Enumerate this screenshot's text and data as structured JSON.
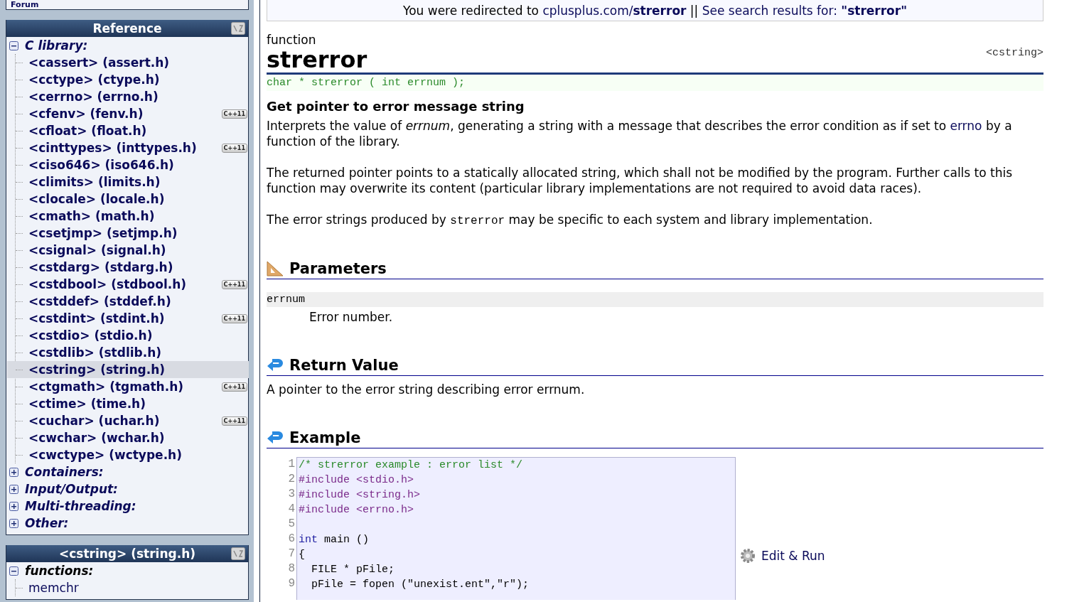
{
  "sidebar": {
    "forum_label": "Forum",
    "reference": {
      "title": "Reference",
      "groups": [
        {
          "label": "C library:",
          "expanded": true,
          "items": [
            {
              "label": "<cassert> (assert.h)",
              "selected": false
            },
            {
              "label": "<cctype> (ctype.h)",
              "selected": false
            },
            {
              "label": "<cerrno> (errno.h)",
              "selected": false
            },
            {
              "label": "<cfenv> (fenv.h)",
              "selected": false,
              "badge": "C++11"
            },
            {
              "label": "<cfloat> (float.h)",
              "selected": false
            },
            {
              "label": "<cinttypes> (inttypes.h)",
              "selected": false,
              "badge": "C++11"
            },
            {
              "label": "<ciso646> (iso646.h)",
              "selected": false
            },
            {
              "label": "<climits> (limits.h)",
              "selected": false
            },
            {
              "label": "<clocale> (locale.h)",
              "selected": false
            },
            {
              "label": "<cmath> (math.h)",
              "selected": false
            },
            {
              "label": "<csetjmp> (setjmp.h)",
              "selected": false
            },
            {
              "label": "<csignal> (signal.h)",
              "selected": false
            },
            {
              "label": "<cstdarg> (stdarg.h)",
              "selected": false
            },
            {
              "label": "<cstdbool> (stdbool.h)",
              "selected": false,
              "badge": "C++11"
            },
            {
              "label": "<cstddef> (stddef.h)",
              "selected": false
            },
            {
              "label": "<cstdint> (stdint.h)",
              "selected": false,
              "badge": "C++11"
            },
            {
              "label": "<cstdio> (stdio.h)",
              "selected": false
            },
            {
              "label": "<cstdlib> (stdlib.h)",
              "selected": false
            },
            {
              "label": "<cstring> (string.h)",
              "selected": true
            },
            {
              "label": "<ctgmath> (tgmath.h)",
              "selected": false,
              "badge": "C++11"
            },
            {
              "label": "<ctime> (time.h)",
              "selected": false
            },
            {
              "label": "<cuchar> (uchar.h)",
              "selected": false,
              "badge": "C++11"
            },
            {
              "label": "<cwchar> (wchar.h)",
              "selected": false
            },
            {
              "label": "<cwctype> (wctype.h)",
              "selected": false
            }
          ]
        },
        {
          "label": "Containers:",
          "expanded": false
        },
        {
          "label": "Input/Output:",
          "expanded": false
        },
        {
          "label": "Multi-threading:",
          "expanded": false
        },
        {
          "label": "Other:",
          "expanded": false
        }
      ]
    },
    "header_panel": {
      "title": "<cstring> (string.h)",
      "groups": [
        {
          "label": "functions:",
          "expanded": true,
          "items": [
            {
              "label": "memchr",
              "selected": false
            }
          ]
        }
      ]
    }
  },
  "redirect_bar": [
    {
      "kind": "text",
      "text": "You were redirected to "
    },
    {
      "kind": "link",
      "text": "cplusplus.com/**strerror**"
    },
    {
      "kind": "text",
      "text": " || "
    },
    {
      "kind": "link",
      "text": "See search results for: **\"strerror\"**"
    }
  ],
  "article": {
    "kind_label": "function",
    "title": "strerror",
    "header": "<cstring>",
    "signature": "char * strerror ( int errnum );",
    "summary": "Get pointer to error message string",
    "paragraphs": [
      [
        {
          "kind": "text",
          "text": "Interprets the value of *errnum*, generating a string with a message that describes the error condition as if set to "
        },
        {
          "kind": "link",
          "text": "errno"
        },
        {
          "kind": "text",
          "text": " by a function of the library."
        }
      ],
      [
        {
          "kind": "text",
          "text": "The returned pointer points to a statically allocated string, which shall not be modified by the program. Further calls to this function may overwrite its content (particular library implementations are not required to avoid data races)."
        }
      ],
      [
        {
          "kind": "text",
          "text": "The error strings produced by "
        },
        {
          "kind": "code",
          "text": "strerror"
        },
        {
          "kind": "text",
          "text": " may be specific to each system and library implementation."
        }
      ]
    ],
    "sections": [
      {
        "kind": "parameters",
        "title": "Parameters",
        "params": [
          {
            "name": "errnum",
            "description": "Error number."
          }
        ]
      },
      {
        "kind": "return",
        "title": "Return Value",
        "text": "A pointer to the error string describing error errnum."
      },
      {
        "kind": "example",
        "title": "Example",
        "code": [
          {
            "number": "1",
            "tokens": [
              {
                "kind": "comment",
                "text": "/* strerror example : error list */"
              }
            ]
          },
          {
            "number": "2",
            "tokens": [
              {
                "kind": "directive",
                "text": "#include <stdio.h>"
              }
            ]
          },
          {
            "number": "3",
            "tokens": [
              {
                "kind": "directive",
                "text": "#include <string.h>"
              }
            ]
          },
          {
            "number": "4",
            "tokens": [
              {
                "kind": "directive",
                "text": "#include <errno.h>"
              }
            ]
          },
          {
            "number": "5"
          },
          {
            "number": "6",
            "tokens": [
              {
                "kind": "keyword",
                "text": "int"
              },
              {
                "kind": "plain",
                "text": " main ()"
              }
            ]
          },
          {
            "number": "7",
            "tokens": [
              {
                "kind": "plain",
                "text": "{"
              }
            ]
          },
          {
            "number": "8",
            "tokens": [
              {
                "kind": "plain",
                "text": "  FILE * pFile;"
              }
            ]
          },
          {
            "number": "9",
            "tokens": [
              {
                "kind": "plain",
                "text": "  pFile = fopen (\"unexist.ent\",\"r\");"
              }
            ]
          }
        ],
        "action": "Edit & Run"
      }
    ]
  }
}
